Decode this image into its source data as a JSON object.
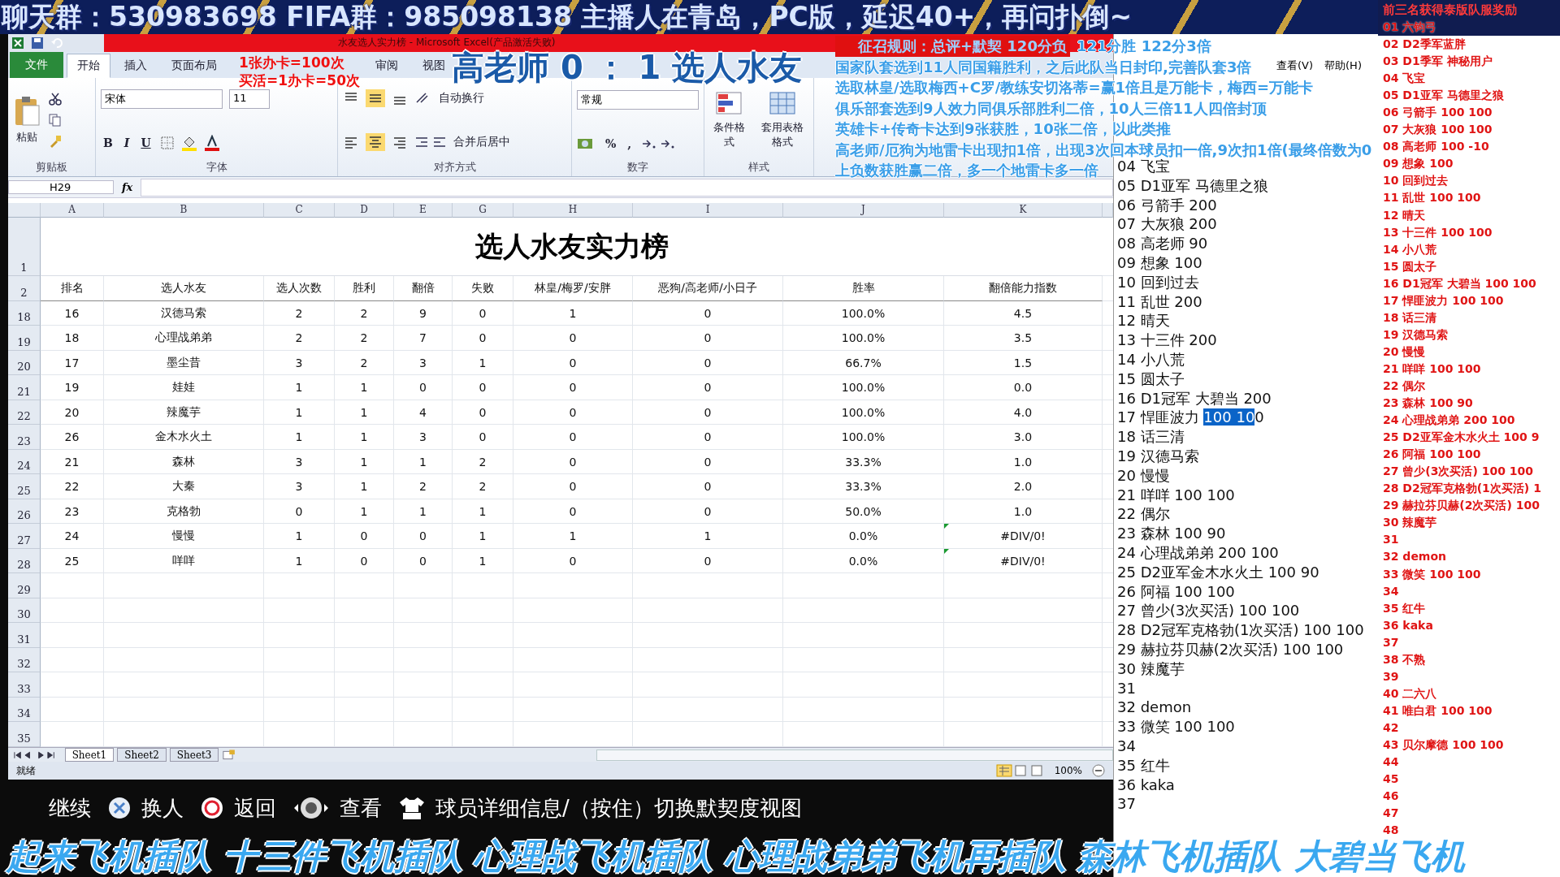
{
  "banner": {
    "text": "聊天群：530983698 FIFA群：985098138 主播人在青岛，PC版，延迟40+，再问扑倒~"
  },
  "excel": {
    "title": "水友选人实力榜 - Microsoft Excel(产品激活失败)",
    "tabs": [
      {
        "label": "文件",
        "kind": "file",
        "selected": false
      },
      {
        "label": "开始",
        "kind": "tab",
        "selected": true
      },
      {
        "label": "插入",
        "kind": "tab",
        "selected": false
      },
      {
        "label": "页面布局",
        "kind": "tab",
        "selected": false
      },
      {
        "label": "审阅",
        "kind": "tab",
        "selected": false
      },
      {
        "label": "视图",
        "kind": "tab",
        "selected": false
      }
    ],
    "ribbon": {
      "paste": "粘贴",
      "font": "宋体",
      "size": "11",
      "format_buttons": [
        "B",
        "I",
        "U"
      ],
      "wrap": "自动换行",
      "merge": "合并后居中",
      "number_format": "常规",
      "number_buttons": [
        "%",
        ","
      ],
      "conditional": "条件格式",
      "table_format": "套用表格格式",
      "groups": [
        "剪贴板",
        "字体",
        "对齐方式",
        "数字",
        "样式"
      ]
    },
    "name_box": "H29",
    "fx": "fx",
    "sheet": {
      "columns": [
        "A",
        "B",
        "C",
        "D",
        "E",
        "G",
        "H",
        "I",
        "J",
        "K"
      ],
      "title_row": {
        "number": "1",
        "title": "选人水友实力榜"
      },
      "header_row": {
        "number": "2",
        "cells": [
          "排名",
          "选人水友",
          "选人次数",
          "胜利",
          "翻倍",
          "失败",
          "林皇/梅罗/安胖",
          "恶狗/高老师/小日子",
          "胜率",
          "翻倍能力指数"
        ]
      },
      "rows": [
        {
          "number": "18",
          "cells": [
            "16",
            "汉德马索",
            "2",
            "2",
            "9",
            "0",
            "1",
            "0",
            "100.0%",
            "4.5"
          ],
          "flagged": false
        },
        {
          "number": "19",
          "cells": [
            "18",
            "心理战弟弟",
            "2",
            "2",
            "7",
            "0",
            "0",
            "0",
            "100.0%",
            "3.5"
          ],
          "flagged": false
        },
        {
          "number": "20",
          "cells": [
            "17",
            "墨尘昔",
            "3",
            "2",
            "3",
            "1",
            "0",
            "0",
            "66.7%",
            "1.5"
          ],
          "flagged": false
        },
        {
          "number": "21",
          "cells": [
            "19",
            "娃娃",
            "1",
            "1",
            "0",
            "0",
            "0",
            "0",
            "100.0%",
            "0.0"
          ],
          "flagged": false
        },
        {
          "number": "22",
          "cells": [
            "20",
            "辣魔芋",
            "1",
            "1",
            "4",
            "0",
            "0",
            "0",
            "100.0%",
            "4.0"
          ],
          "flagged": false
        },
        {
          "number": "23",
          "cells": [
            "26",
            "金木水火土",
            "1",
            "1",
            "3",
            "0",
            "0",
            "0",
            "100.0%",
            "3.0"
          ],
          "flagged": false
        },
        {
          "number": "24",
          "cells": [
            "21",
            "森林",
            "3",
            "1",
            "1",
            "2",
            "0",
            "0",
            "33.3%",
            "1.0"
          ],
          "flagged": false
        },
        {
          "number": "25",
          "cells": [
            "22",
            "大秦",
            "3",
            "1",
            "2",
            "2",
            "0",
            "0",
            "33.3%",
            "2.0"
          ],
          "flagged": false
        },
        {
          "number": "26",
          "cells": [
            "23",
            "克格勃",
            "0",
            "1",
            "1",
            "1",
            "0",
            "0",
            "50.0%",
            "1.0"
          ],
          "flagged": false
        },
        {
          "number": "27",
          "cells": [
            "24",
            "慢慢",
            "1",
            "0",
            "0",
            "1",
            "1",
            "1",
            "0.0%",
            "#DIV/0!"
          ],
          "flagged": true
        },
        {
          "number": "28",
          "cells": [
            "25",
            "咩咩",
            "1",
            "0",
            "0",
            "1",
            "0",
            "0",
            "0.0%",
            "#DIV/0!"
          ],
          "flagged": true
        }
      ],
      "empty_rows": [
        "29",
        "30",
        "31",
        "32",
        "33",
        "34",
        "35"
      ]
    },
    "sheet_tabs": [
      {
        "label": "Sheet1",
        "selected": true
      },
      {
        "label": "Sheet2",
        "selected": false
      },
      {
        "label": "Sheet3",
        "selected": false
      }
    ],
    "status": {
      "ready": "就绪",
      "zoom": "100%"
    }
  },
  "overlay": {
    "notes": [
      "1张办卡=100次",
      "买活=1办卡=50次"
    ],
    "score": "高老师 0 ： 1 选人水友",
    "rules_head": "征召规则：总评+默契 120分负",
    "rules_head_rest": "121分胜 122分3倍",
    "rules": [
      "国家队套选到11人同国籍胜利，之后此队当日封印,完善队套3倍",
      "选取林皇/选取梅西+C罗/教练安切洛蒂=赢1倍且是万能卡，梅西=万能卡",
      "俱乐部套选到9人效力同俱乐部胜利二倍，10人三倍11人四倍封顶",
      "英雄卡+传奇卡达到9张获胜，10张二倍，以此类推",
      "高老师/厄狗为地雷卡出现扣1倍，出现3次回本球员扣一倍,9次扣1倍(最终倍数为0",
      "上负数获胜赢二倍，多一个地雷卡多一倍"
    ]
  },
  "notepad": {
    "menu": [
      "查看(V)",
      "帮助(H)"
    ],
    "lines": [
      {
        "text": "04 飞宝"
      },
      {
        "text": "05 D1亚军 马德里之狼"
      },
      {
        "text": "06 弓箭手 200"
      },
      {
        "text": "07 大灰狼 200"
      },
      {
        "text": "08 高老师 90"
      },
      {
        "text": "09 想象 100"
      },
      {
        "text": "10 回到过去"
      },
      {
        "text": "11 乱世 200"
      },
      {
        "text": "12 晴天"
      },
      {
        "text": "13 十三件 200"
      },
      {
        "text": "14 小八荒"
      },
      {
        "text": "15 圆太子"
      },
      {
        "text": "16 D1冠军 大碧当 200"
      },
      {
        "text": "17 悍匪波力 ",
        "highlight": "100 10",
        "rest": "0"
      },
      {
        "text": "18 话三清"
      },
      {
        "text": "19 汉德马索"
      },
      {
        "text": "20 慢慢"
      },
      {
        "text": "21 咩咩 100 100"
      },
      {
        "text": "22 偶尔"
      },
      {
        "text": "23 森林 100 90"
      },
      {
        "text": "24 心理战弟弟 200 100"
      },
      {
        "text": "25 D2亚军金木水火土 100 90"
      },
      {
        "text": "26 阿福 100 100"
      },
      {
        "text": "27 曾少(3次买活) 100 100"
      },
      {
        "text": "28 D2冠军克格勃(1次买活) 100 100"
      },
      {
        "text": "29 赫拉芬贝赫(2次买活) 100 100"
      },
      {
        "text": "30 辣魔芋"
      },
      {
        "text": "31"
      },
      {
        "text": "32 demon"
      },
      {
        "text": "33 微笑 100 100"
      },
      {
        "text": "34"
      },
      {
        "text": "35 红牛"
      },
      {
        "text": "36 kaka"
      },
      {
        "text": "37"
      }
    ]
  },
  "rewards": {
    "title": "前三名获得泰版队服奖励",
    "items": [
      "01 六钧弓",
      "02 D2季军蓝胖",
      "03 D1季军 神秘用户",
      "04 飞宝",
      "05 D1亚军 马德里之狼",
      "06 弓箭手 100 100",
      "07 大灰狼 100 100",
      "08 高老师 100 -10",
      "09 想象 100",
      "10 回到过去",
      "11 乱世 100 100",
      "12 晴天",
      "13 十三件 100 100",
      "14 小八荒",
      "15 圆太子",
      "16 D1冠军 大碧当 100 100",
      "17 悍匪波力 100 100",
      "18 话三清",
      "19 汉德马索",
      "20 慢慢",
      "21 咩咩 100 100",
      "22 偶尔",
      "23 森林 100 90",
      "24 心理战弟弟 200 100",
      "25 D2亚军金木水火土 100 9",
      "26 阿福 100 100",
      "27 曾少(3次买活) 100 100",
      "28 D2冠军克格勃(1次买活) 1",
      "29 赫拉芬贝赫(2次买活) 100",
      "30 辣魔芋",
      "31",
      "32 demon",
      "33 微笑 100 100",
      "34",
      "35 红牛",
      "36 kaka",
      "37",
      "38 不熟",
      "39",
      "40 二六八",
      "41 唯白君 100 100",
      "42",
      "43 贝尔摩德 100 100",
      "44",
      "45",
      "46",
      "47",
      "48"
    ]
  },
  "hints": [
    {
      "kind": "cross",
      "label": "换人"
    },
    {
      "kind": "ring",
      "label": "返回"
    },
    {
      "kind": "stick",
      "label": "查看"
    },
    {
      "kind": "shirt",
      "label": "球员详细信息/（按住）切换默契度视图"
    }
  ],
  "hint_first": "继续",
  "ticker": "起来飞机插队 十三件飞机插队 心理战飞机插队 心理战弟弟飞机再插队 森林飞机插队 大碧当飞机"
}
